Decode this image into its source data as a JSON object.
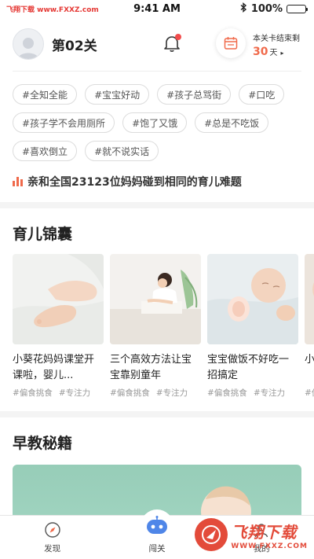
{
  "status_bar": {
    "site_mark": "飞翔下载 www.FXXZ.com",
    "time": "9:41 AM",
    "battery": "100%",
    "battery_level": 1.0
  },
  "header": {
    "level_label": "第02关",
    "remain_label": "本关卡结束剩",
    "remain_days": "30",
    "remain_unit": "天",
    "remain_arrow": "▸",
    "accent": "#f06a4b"
  },
  "tags": [
    "#全知全能",
    "#宝宝好动",
    "#孩子总骂街",
    "#口吃",
    "#孩子学不会用厕所",
    "#饱了又饿",
    "#总是不吃饭",
    "#喜欢倒立",
    "#就不说实话"
  ],
  "notice": {
    "text": "亲和全国23123位妈妈碰到相同的育儿难题"
  },
  "section1": {
    "title": "育儿锦囊",
    "cards": [
      {
        "title": "小葵花妈妈课堂开课啦，婴儿...",
        "tags": [
          "#偏食挑食",
          "#专注力"
        ]
      },
      {
        "title": "三个高效方法让宝宝靠别童年",
        "tags": [
          "#偏食挑食",
          "#专注力"
        ]
      },
      {
        "title": "宝宝做饭不好吃一招搞定",
        "tags": [
          "#偏食挑食",
          "#专注力"
        ]
      },
      {
        "title": "小...",
        "tags": [
          "#偏"
        ]
      }
    ]
  },
  "section2": {
    "title": "早教秘籍"
  },
  "tabbar": {
    "items": [
      {
        "label": "发现",
        "icon": "compass-icon"
      },
      {
        "label": "闯关",
        "icon": "robot-icon"
      },
      {
        "label": "我的",
        "icon": "user-icon"
      }
    ]
  },
  "watermark": {
    "brand_cn": "飞翔下载",
    "brand_en": "WWW.FXXZ.COM"
  }
}
